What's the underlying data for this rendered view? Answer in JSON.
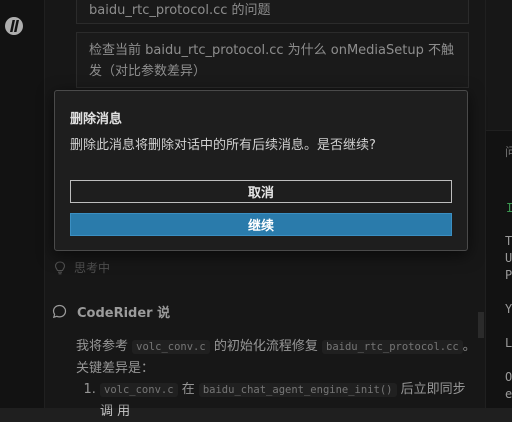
{
  "activity_bar": {
    "logo": "codesrider-logo"
  },
  "history": {
    "card1_text": "baidu_rtc_protocol.cc 的问题",
    "card2_line1": "检查当前 baidu_rtc_protocol.cc 为什么 onMediaSetup 不触",
    "card2_line2": "发（对比参数差异）"
  },
  "thinking": {
    "label": "思考中",
    "icon": "lightbulb-icon"
  },
  "response": {
    "speaker": "CodeRider 说",
    "icon": "chat-bubble-icon",
    "p1_a": "我将参考",
    "p1_code1": "volc_conv.c",
    "p1_b": "的初始化流程修复",
    "p1_code2": "baidu_rtc_protocol.cc",
    "p1_c": "。",
    "p2": "关键差异是：",
    "li1_code1": "volc_conv.c",
    "li1_a": "在",
    "li1_code2": "baidu_chat_agent_engine_init()",
    "li1_b": "后立即同步调",
    "li1_c": "用"
  },
  "right_panel": {
    "lines": [
      "问",
      "I",
      "T",
      "U",
      "P",
      "Y",
      "L",
      "O",
      "e"
    ]
  },
  "dialog": {
    "title": "删除消息",
    "message": "删除此消息将删除对话中的所有后续消息。是否继续?",
    "cancel_label": "取消",
    "continue_label": "继续"
  },
  "colors": {
    "accent": "#2a7bab",
    "background": "#1f1f1f"
  }
}
